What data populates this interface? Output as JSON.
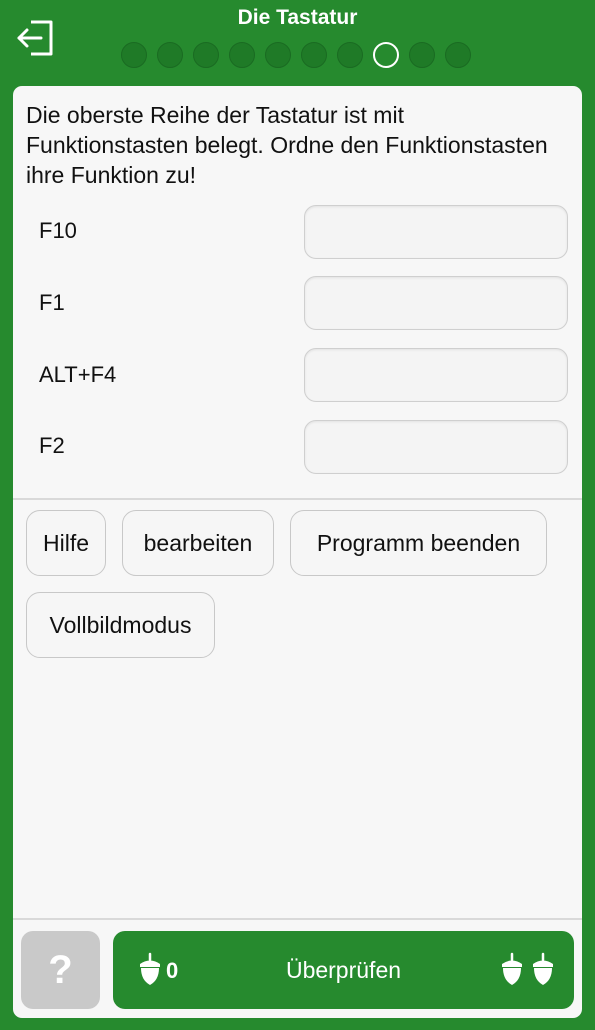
{
  "header": {
    "title": "Die Tastatur",
    "progress_total": 10,
    "progress_current_index": 7
  },
  "question": {
    "text": "Die oberste Reihe der Tastatur ist mit Funktionstasten belegt. Ordne den Funktionstasten ihre Funktion zu!"
  },
  "pairs": [
    {
      "key": "F10",
      "answer": ""
    },
    {
      "key": "F1",
      "answer": ""
    },
    {
      "key": "ALT+F4",
      "answer": ""
    },
    {
      "key": "F2",
      "answer": ""
    }
  ],
  "options": [
    {
      "label": "Hilfe"
    },
    {
      "label": "bearbeiten"
    },
    {
      "label": "Programm beenden"
    },
    {
      "label": "Vollbildmodus"
    }
  ],
  "footer": {
    "help_label": "?",
    "check_label": "Überprüfen",
    "acorn_count": "0"
  },
  "colors": {
    "brand_green": "#268a2e",
    "card_bg": "#f7f7f7",
    "help_disabled": "#c9c9c9"
  }
}
